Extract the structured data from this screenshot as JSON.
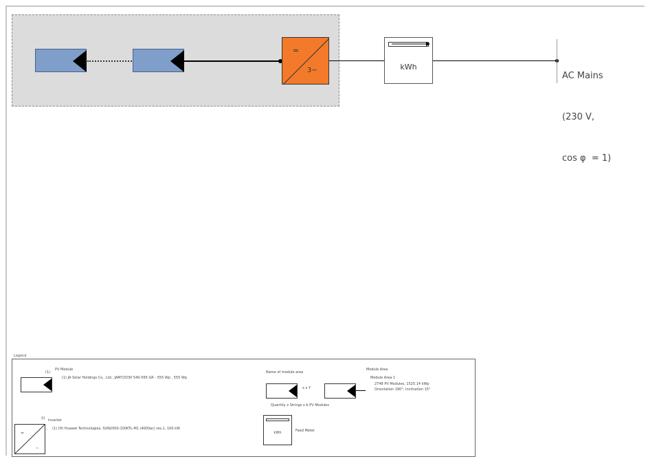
{
  "diagram": {
    "inverter": {
      "dc_symbol": "=",
      "ac_symbol": "3~"
    },
    "meter": {
      "unit_label": "kWh"
    },
    "grid": {
      "lines": [
        "AC Mains",
        "(230 V,",
        "cos φ  = 1)"
      ]
    }
  },
  "legend": {
    "title": "Legend",
    "pv_module": {
      "count": "(1)",
      "heading": "PV Module",
      "detail": "(1) JA Solar Holdings Co., Ltd., JAM72D30 540-565 GR - 555 Wp , 555 Wp"
    },
    "inverter": {
      "count": "(I)",
      "heading": "Inverter",
      "detail": "(1) (H) Huawei Technologies, SUN2000-100KTL-M1 (400Vac) rev.1, 100 kW"
    },
    "module_area_caption": "Name of module area",
    "string_text": "x x Y",
    "quantity_text": "Quantity x Strings x b PV Modules",
    "module_area": {
      "heading": "Module Area",
      "name": "Module Area 1",
      "modules": "2748 PV Modules, 1525.14 kWp",
      "orientation": "Orientation 180°, Inclination 15°"
    },
    "feed_meter": "Feed Meter",
    "meter_unit": "kWh"
  },
  "colors": {
    "pv_module_fill": "#7f9fca",
    "inverter_fill": "#f27a2a",
    "pv_area_fill": "#dcdcdc"
  }
}
